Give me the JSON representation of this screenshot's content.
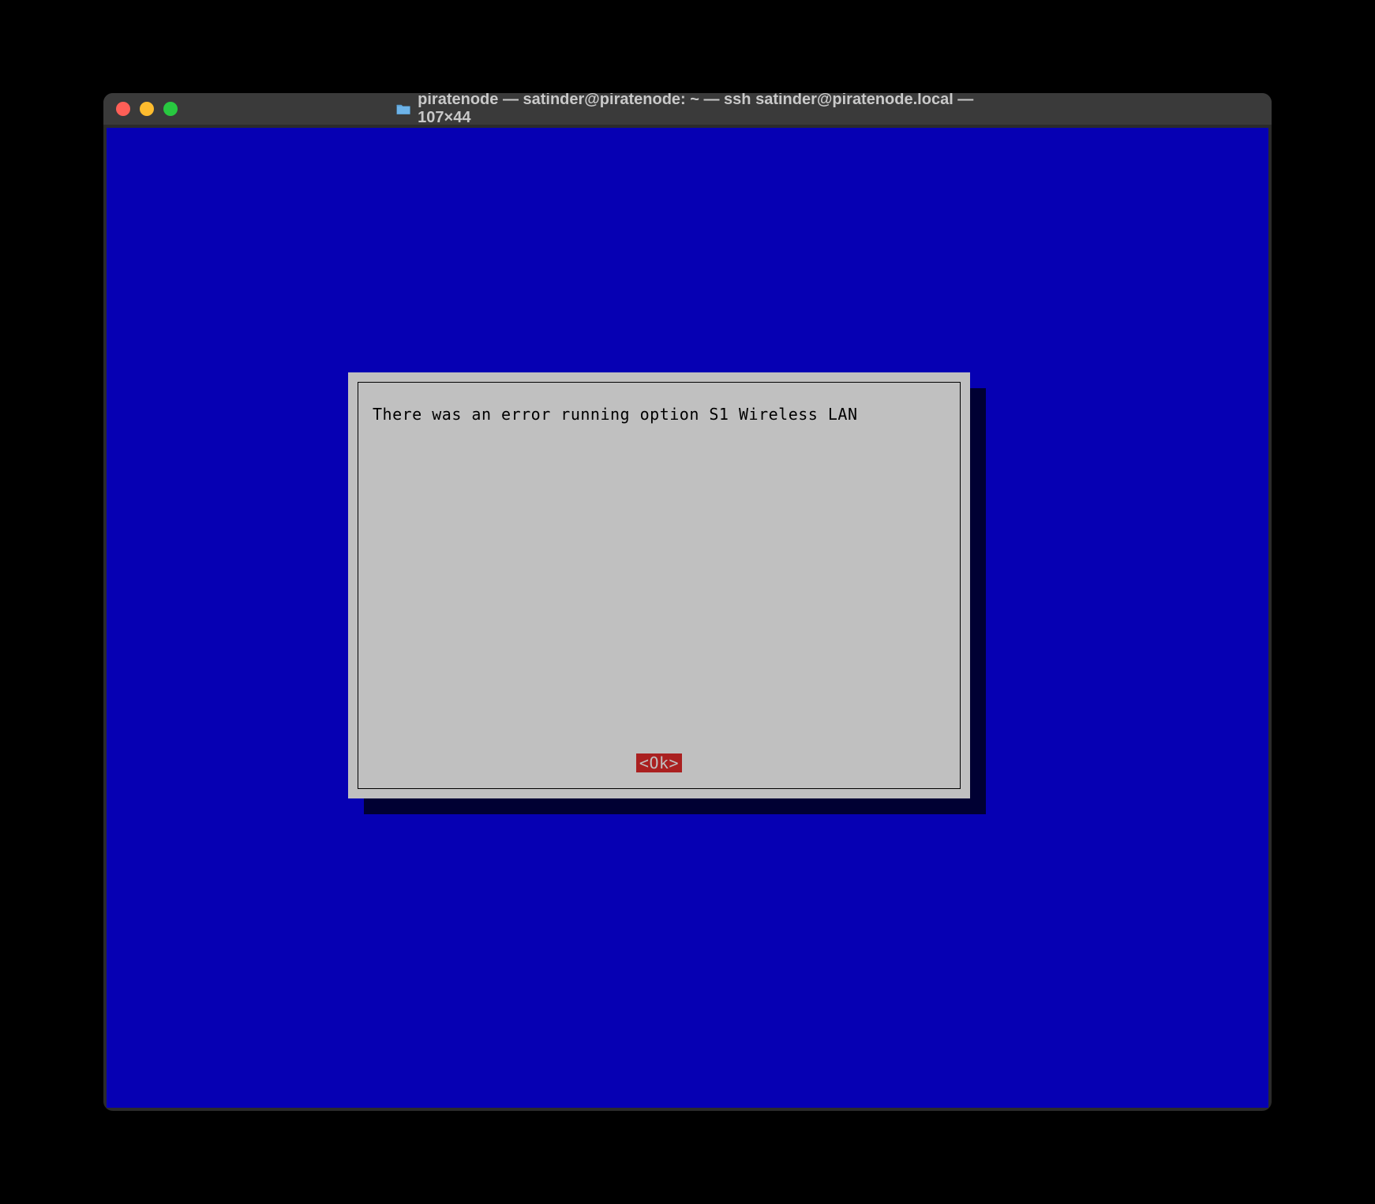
{
  "window": {
    "title": "piratenode — satinder@piratenode: ~ — ssh satinder@piratenode.local — 107×44"
  },
  "dialog": {
    "message": "There was an error running option S1 Wireless LAN",
    "ok_label": "<Ok>"
  }
}
